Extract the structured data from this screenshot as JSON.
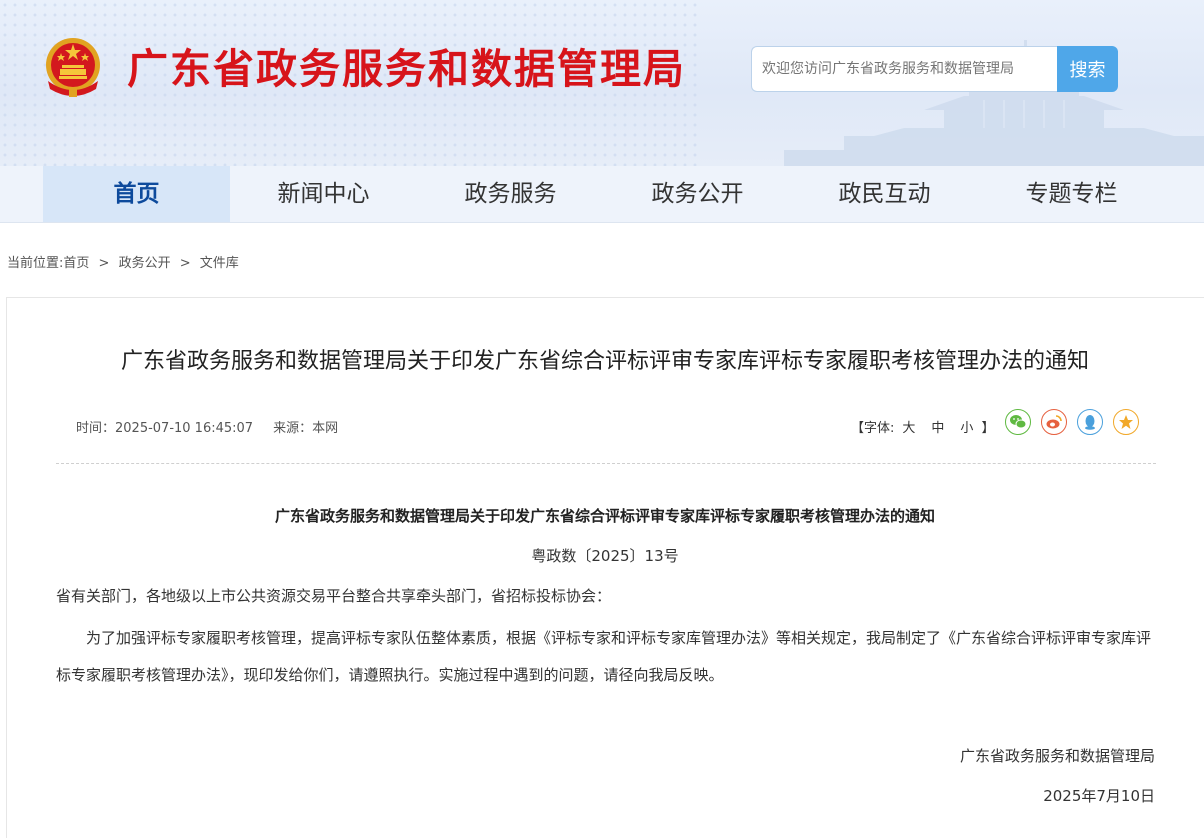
{
  "header": {
    "site_title": "广东省政务服务和数据管理局",
    "search_placeholder": "欢迎您访问广东省政务服务和数据管理局",
    "search_button": "搜索"
  },
  "nav": {
    "items": [
      {
        "label": "首页",
        "active": true
      },
      {
        "label": "新闻中心"
      },
      {
        "label": "政务服务"
      },
      {
        "label": "政务公开"
      },
      {
        "label": "政民互动"
      },
      {
        "label": "专题专栏"
      }
    ]
  },
  "breadcrumb": {
    "prefix": "当前位置:",
    "items": [
      "首页",
      "政务公开",
      "文件库"
    ],
    "separator": ">"
  },
  "article": {
    "title": "广东省政务服务和数据管理局关于印发广东省综合评标评审专家库评标专家履职考核管理办法的通知",
    "time_label": "时间：2025-07-10 16:45:07",
    "source_label": "来源：本网",
    "font_size": {
      "open": "【字体:",
      "large": "大",
      "medium": "中",
      "small": "小",
      "close": "】"
    },
    "share_icons": [
      {
        "name": "wechat-icon",
        "color": "#5fb941"
      },
      {
        "name": "weibo-icon",
        "color": "#e6603f"
      },
      {
        "name": "qq-icon",
        "color": "#4aa0dc"
      },
      {
        "name": "favorite-icon",
        "color": "#f1a829"
      }
    ]
  },
  "document": {
    "title": "广东省政务服务和数据管理局关于印发广东省综合评标评审专家库评标专家履职考核管理办法的通知",
    "doc_number": "粤政数〔2025〕13号",
    "salutation": "省有关部门，各地级以上市公共资源交易平台整合共享牵头部门，省招标投标协会：",
    "paragraph": "为了加强评标专家履职考核管理，提高评标专家队伍整体素质，根据《评标专家和评标专家库管理办法》等相关规定，我局制定了《广东省综合评标评审专家库评标专家履职考核管理办法》，现印发给你们，请遵照执行。实施过程中遇到的问题，请径向我局反映。",
    "signature": "广东省政务服务和数据管理局",
    "date": "2025年7月10日"
  },
  "colors": {
    "title_red": "#d7141a",
    "nav_active_text": "#0d4a9c",
    "search_button": "#4fa7e9"
  }
}
